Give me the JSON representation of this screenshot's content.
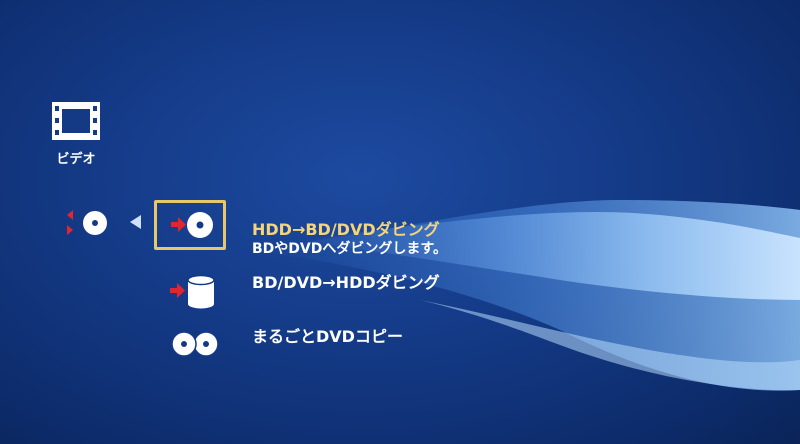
{
  "category": {
    "label": "ビデオ",
    "icon": "film-icon"
  },
  "side_item": {
    "icon": "disc-swap-icon"
  },
  "menu": {
    "items": [
      {
        "icon": "disc-import-icon",
        "title": "HDD→BD/DVDダビング",
        "description": "BDやDVDへダビングします。",
        "selected": true
      },
      {
        "icon": "hdd-import-icon",
        "title": "BD/DVD→HDDダビング",
        "description": ""
      },
      {
        "icon": "double-disc-icon",
        "title": "まるごとDVDコピー",
        "description": ""
      }
    ]
  },
  "colors": {
    "accent": "#e8c66a",
    "arrow": "#e0262e",
    "background": "#143a86"
  }
}
